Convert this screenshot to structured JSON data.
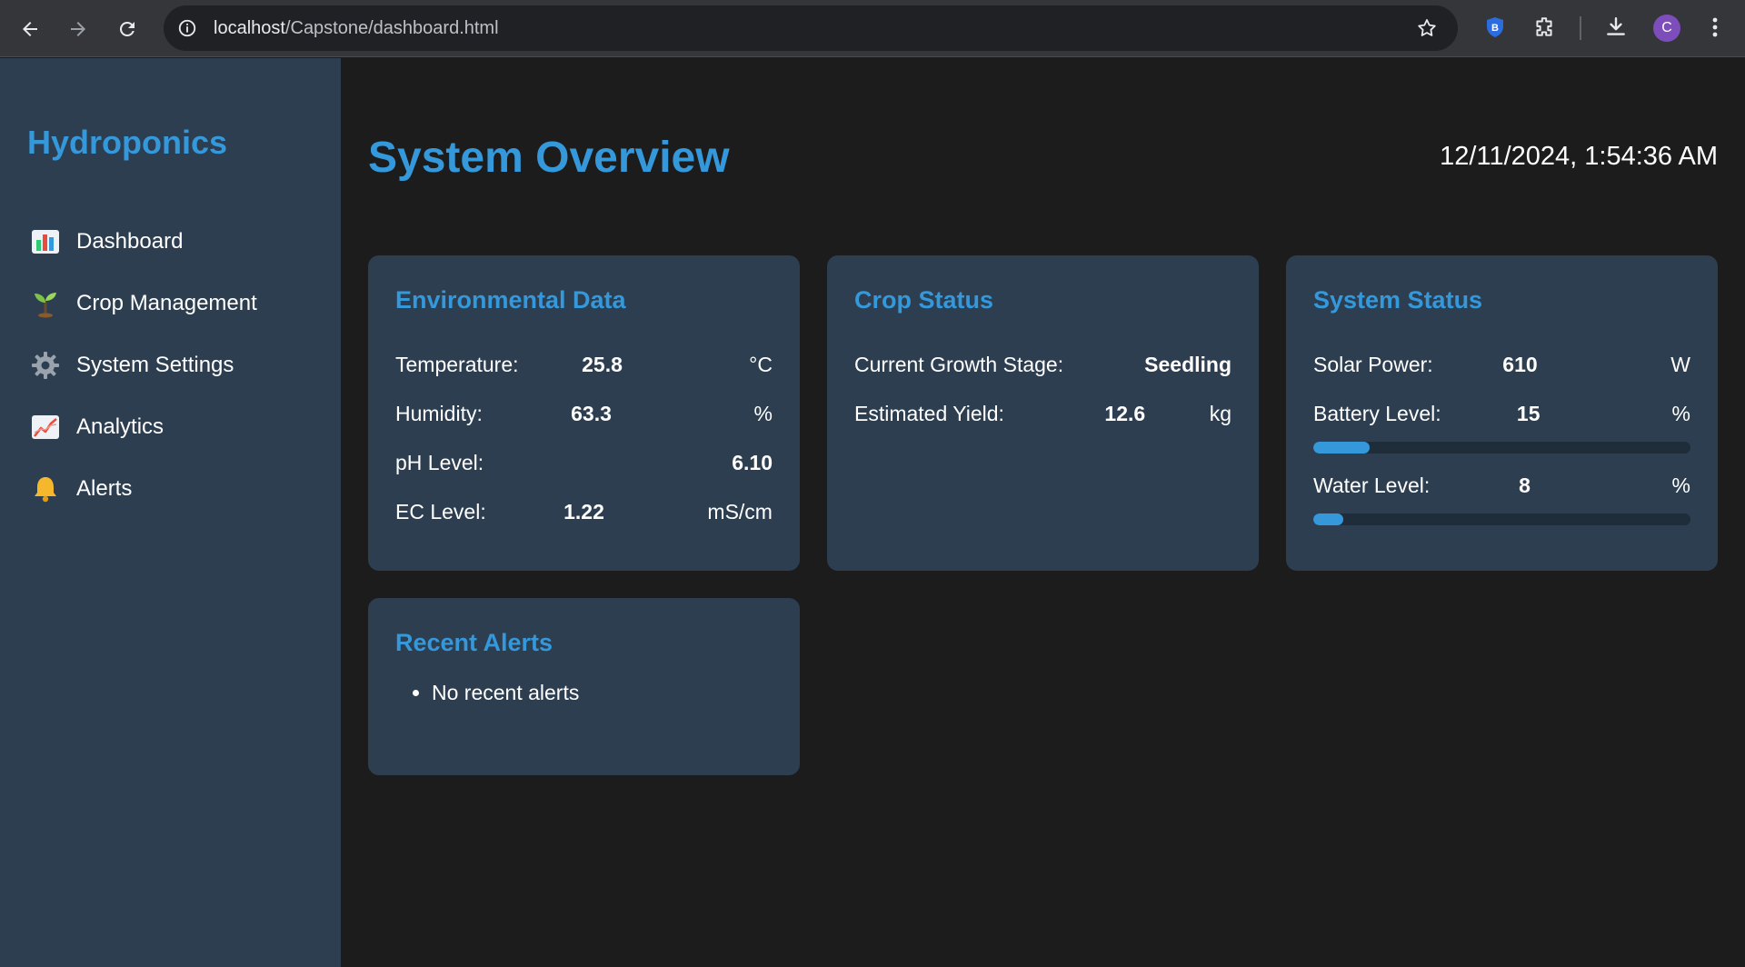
{
  "browser": {
    "url_host": "localhost",
    "url_path": "/Capstone/dashboard.html",
    "avatar_letter": "C"
  },
  "sidebar": {
    "brand": "Hydroponics",
    "items": [
      {
        "label": "Dashboard",
        "icon": "chart-bars-icon"
      },
      {
        "label": "Crop Management",
        "icon": "seedling-icon"
      },
      {
        "label": "System Settings",
        "icon": "gear-icon"
      },
      {
        "label": "Analytics",
        "icon": "line-chart-icon"
      },
      {
        "label": "Alerts",
        "icon": "bell-icon"
      }
    ]
  },
  "header": {
    "title": "System Overview",
    "datetime": "12/11/2024, 1:54:36 AM"
  },
  "environmental": {
    "title": "Environmental Data",
    "temperature": {
      "label": "Temperature:",
      "value": "25.8",
      "unit": "°C"
    },
    "humidity": {
      "label": "Humidity:",
      "value": "63.3",
      "unit": "%"
    },
    "ph": {
      "label": "pH Level:",
      "value": "6.10"
    },
    "ec": {
      "label": "EC Level:",
      "value": "1.22",
      "unit": "mS/cm"
    }
  },
  "crop": {
    "title": "Crop Status",
    "stage": {
      "label": "Current Growth Stage:",
      "value": "Seedling"
    },
    "yield": {
      "label": "Estimated Yield:",
      "value": "12.6",
      "unit": "kg"
    }
  },
  "system": {
    "title": "System Status",
    "solar": {
      "label": "Solar Power:",
      "value": "610",
      "unit": "W"
    },
    "battery": {
      "label": "Battery Level:",
      "value": "15",
      "unit": "%",
      "percent": 15
    },
    "water": {
      "label": "Water Level:",
      "value": "8",
      "unit": "%",
      "percent": 8
    }
  },
  "alerts": {
    "title": "Recent Alerts",
    "items": [
      "No recent alerts"
    ]
  },
  "colors": {
    "accent": "#3498db",
    "card_bg": "#2c3e50",
    "page_bg": "#1c1c1d"
  }
}
